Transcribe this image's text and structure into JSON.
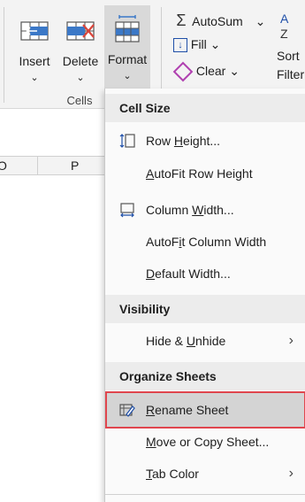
{
  "ribbon": {
    "insert_label": "Insert",
    "delete_label": "Delete",
    "format_label": "Format",
    "chevron": "⌄",
    "group_label": "Cells",
    "autosum_label": "AutoSum",
    "autosum_chevron": "⌄",
    "fill_label": "Fill",
    "fill_chevron": "⌄",
    "clear_label": "Clear",
    "clear_chevron": "⌄",
    "sort_label_1": "Sort",
    "sort_label_2": "Filter"
  },
  "sheet": {
    "columns": [
      "O",
      "P"
    ]
  },
  "menu": {
    "sections": {
      "cell_size": "Cell Size",
      "visibility": "Visibility",
      "organize": "Organize Sheets"
    },
    "items": {
      "row_height": {
        "pre": "Row ",
        "u": "H",
        "post": "eight..."
      },
      "autofit_row": {
        "pre": "",
        "u": "A",
        "post": "utoFit Row Height"
      },
      "column_width": {
        "pre": "Column ",
        "u": "W",
        "post": "idth..."
      },
      "autofit_column": {
        "pre": "AutoF",
        "u": "i",
        "post": "t Column Width"
      },
      "default_width": {
        "pre": "",
        "u": "D",
        "post": "efault Width..."
      },
      "hide_unhide": {
        "pre": "Hide & ",
        "u": "U",
        "post": "nhide"
      },
      "rename_sheet": {
        "pre": "",
        "u": "R",
        "post": "ename Sheet"
      },
      "move_copy": {
        "pre": "",
        "u": "M",
        "post": "ove or Copy Sheet..."
      },
      "tab_color": {
        "pre": "",
        "u": "T",
        "post": "ab Color"
      }
    },
    "submenu_arrow": "›",
    "selected": "rename_sheet"
  },
  "colors": {
    "accent_blue": "#1f4fa8",
    "highlight_outline": "#e0464e",
    "selected_bg": "#d4d4d4",
    "delete_red": "#d9453b"
  }
}
